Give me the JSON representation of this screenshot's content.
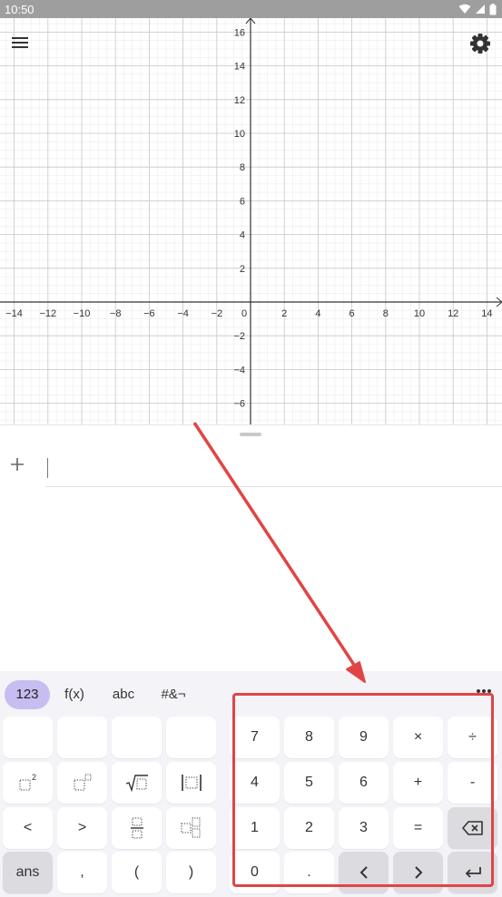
{
  "status_bar": {
    "time": "10:50",
    "icons": [
      "wifi-icon",
      "signal-icon",
      "battery-icon"
    ]
  },
  "graph": {
    "x_ticks": [
      "−14",
      "−12",
      "−10",
      "−8",
      "−6",
      "−4",
      "−2",
      "0",
      "2",
      "4",
      "6",
      "8",
      "10",
      "12",
      "14"
    ],
    "y_ticks_positive": [
      "16",
      "14",
      "12",
      "10",
      "8",
      "6",
      "4",
      "2"
    ],
    "y_ticks_negative": [
      "−2",
      "−4",
      "−6"
    ],
    "axis_color": "#333333",
    "major_grid_color": "#c8c8c8",
    "minor_grid_color": "#ececec"
  },
  "algebra": {
    "input_value": "",
    "add_icon": "plus-icon"
  },
  "keyboard": {
    "tabs": [
      "123",
      "f(x)",
      "abc",
      "#&¬"
    ],
    "active_tab": "123",
    "accent_color": "#c8bdf0",
    "left_keys": [
      [
        "",
        "",
        "",
        ""
      ],
      [
        "□²",
        "□ⁿ",
        "√□",
        "|□|"
      ],
      [
        "<",
        ">",
        "□/□",
        "□ₙ"
      ],
      [
        "ans",
        ",",
        "(",
        ")"
      ]
    ],
    "right_keys": [
      [
        "7",
        "8",
        "9",
        "×",
        "÷"
      ],
      [
        "4",
        "5",
        "6",
        "+",
        "-"
      ],
      [
        "1",
        "2",
        "3",
        "=",
        "⌫"
      ],
      [
        "0",
        ".",
        "<",
        ">",
        "↵"
      ]
    ]
  },
  "annotation": {
    "color": "#e04545"
  }
}
